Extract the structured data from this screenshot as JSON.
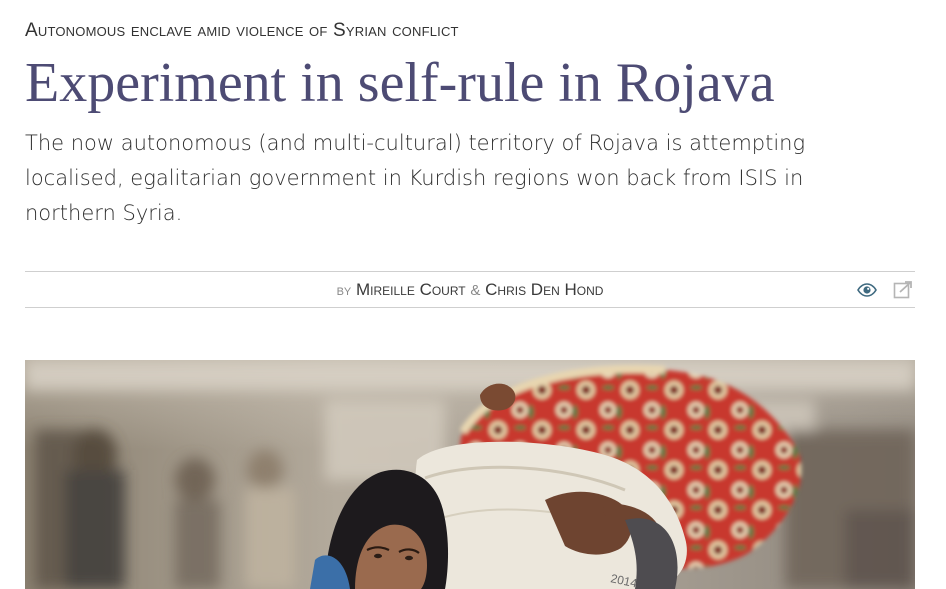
{
  "article": {
    "kicker": "Autonomous enclave amid violence of Syrian conflict",
    "headline": "Experiment in self-rule in Rojava",
    "standfirst": "The now autonomous (and multi-cultural) territory of Rojava is attempting localised, egalitarian government in Kurdish regions won back from ISIS in northern Syria.",
    "byline": {
      "by": "by",
      "authors": [
        "Mireille Court",
        "Chris Den Hond"
      ],
      "separator": "&"
    }
  },
  "actions": {
    "view_icon": "eye-icon",
    "share_icon": "external-link-icon"
  },
  "hero_image": {
    "bag_number": "2014"
  },
  "colors": {
    "headline": "#4d4b74",
    "accent_icon": "#3f6a80"
  }
}
